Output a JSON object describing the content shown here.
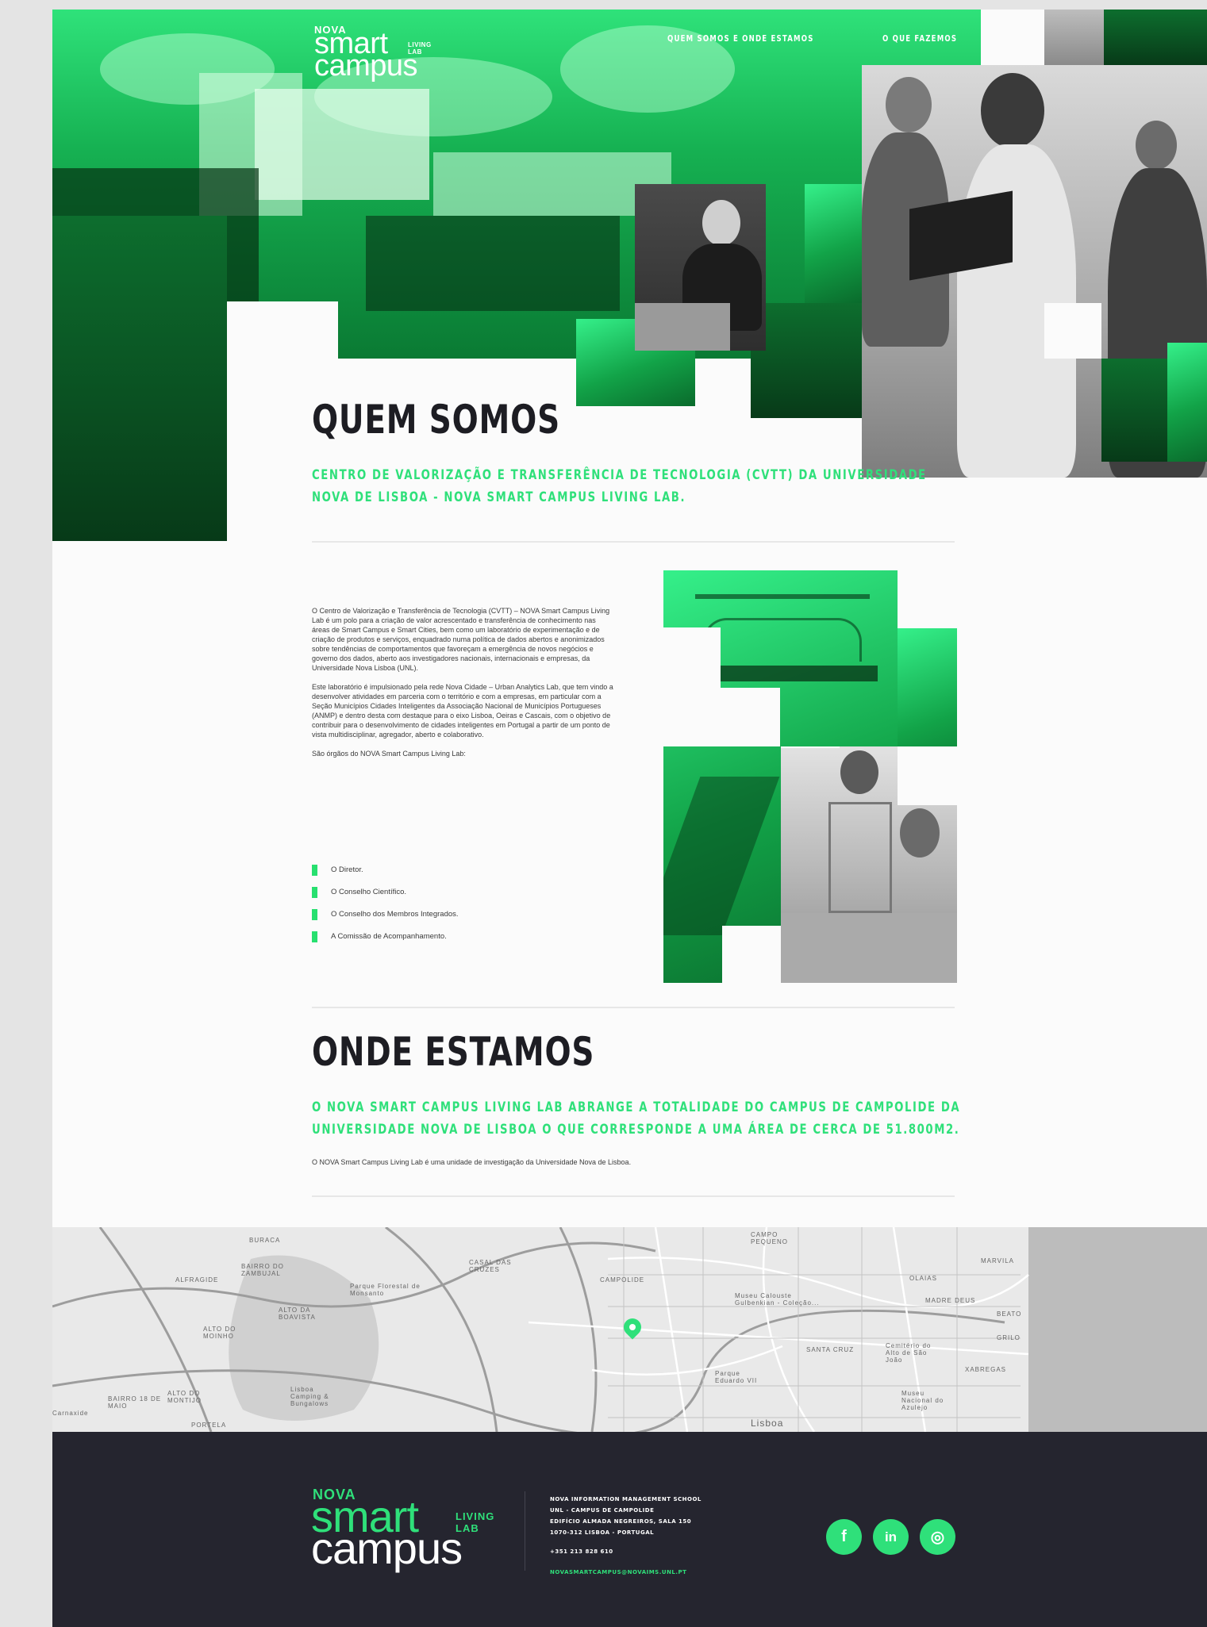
{
  "brand": {
    "nova": "NOVA",
    "smart": "smart",
    "campus": "campus",
    "living_lab_line1": "LIVING",
    "living_lab_line2": "LAB",
    "accent_color": "#2fe07a",
    "footer_bg": "#25252f"
  },
  "nav": {
    "items": [
      {
        "label": "QUEM SOMOS E ONDE ESTAMOS"
      },
      {
        "label": "O QUE FAZEMOS"
      }
    ]
  },
  "quem_somos": {
    "title": "QUEM SOMOS",
    "lead": "CENTRO DE VALORIZAÇÃO E TRANSFERÊNCIA DE TECNOLOGIA (CVTT) DA UNIVERSIDADE NOVA DE LISBOA - NOVA SMART CAMPUS LIVING LAB.",
    "paragraph1": "O Centro de Valorização e Transferência de Tecnologia (CVTT) – NOVA Smart Campus Living Lab é um polo para a criação de valor acrescentado e transferência de conhecimento nas áreas de Smart Campus e Smart Cities, bem como um laboratório de experimentação e de criação de produtos e serviços, enquadrado numa política de dados abertos e anonimizados sobre tendências de comportamentos que favoreçam a emergência de novos negócios e governo dos dados, aberto aos investigadores nacionais, internacionais e empresas, da Universidade Nova Lisboa (UNL).",
    "paragraph2": "Este laboratório é impulsionado pela rede Nova Cidade – Urban Analytics Lab, que tem vindo a desenvolver atividades em parceria com o território e com a empresas, em particular com a Seção Municípios Cidades Inteligentes da Associação Nacional de Municípios Portugueses (ANMP) e dentro desta com destaque para o eixo Lisboa, Oeiras e Cascais, com o objetivo de contribuir para o desenvolvimento de cidades inteligentes em Portugal a partir de um ponto de vista multidisciplinar, agregador, aberto e colaborativo.",
    "organs_intro": "São órgãos do NOVA Smart Campus Living Lab:",
    "organs": [
      {
        "label": "O Diretor."
      },
      {
        "label": "O Conselho Científico."
      },
      {
        "label": "O Conselho dos Membros Integrados."
      },
      {
        "label": "A Comissão de Acompanhamento."
      }
    ]
  },
  "onde_estamos": {
    "title": "ONDE ESTAMOS",
    "lead": "O NOVA SMART CAMPUS LIVING LAB ABRANGE A TOTALIDADE DO CAMPUS DE CAMPOLIDE DA UNIVERSIDADE NOVA DE LISBOA O QUE CORRESPONDE A UMA ÁREA DE CERCA DE 51.800M2.",
    "note": "O NOVA Smart Campus Living Lab é uma unidade de investigação da Universidade Nova de Lisboa."
  },
  "map": {
    "labels": {
      "buraca": "Buraca",
      "bairro_zambujal": "BAIRRO DO ZAMBUJAL",
      "alfragide": "Alfragide",
      "alto_boavista": "ALTO DA BOAVISTA",
      "alto_moinho": "ALTO DO MOINHO",
      "parque_monsanto": "Parque Florestal de Monsanto",
      "cabo_cruzes": "CASAL DAS CRUZES",
      "campolide": "CAMPOLIDE",
      "campo_pequeno": "CAMPO PEQUENO",
      "gulbenkian": "Museu Calouste Gulbenkian - Coleção...",
      "olaias": "OLAIAS",
      "madre_deus": "MADRE DEUS",
      "marvila": "MARVILA",
      "beato": "BEATO",
      "santa_cruz": "SANTA CRUZ",
      "cemiterio": "Cemitério do Alto de São João",
      "xabregas": "XABREGAS",
      "parque_eduardo": "Parque Eduardo VII",
      "bairro_maio": "BAIRRO 18 DE MAIO",
      "alto_montijo": "ALTO DO MONTIJO",
      "jardim": "Lisboa Camping & Bungalows",
      "portela": "PORTELA",
      "carnaxide": "Carnaxide",
      "lisboa": "Lisboa",
      "azulejo": "Museu Nacional do Azulejo",
      "grilo": "GRILO"
    }
  },
  "footer": {
    "address_line1": "NOVA INFORMATION MANAGEMENT SCHOOL",
    "address_line2": "UNL - CAMPUS DE CAMPOLIDE",
    "address_line3": "EDIFÍCIO ALMADA NEGREIROS, SALA 150",
    "address_line4": "1070-312 LISBOA - PORTUGAL",
    "phone": "+351 213 828 610",
    "email": "NOVASMARTCAMPUS@NOVAIMS.UNL.PT",
    "social": [
      {
        "icon": "facebook-icon",
        "glyph": "f"
      },
      {
        "icon": "linkedin-icon",
        "glyph": "in"
      },
      {
        "icon": "instagram-icon",
        "glyph": "◎"
      }
    ]
  }
}
